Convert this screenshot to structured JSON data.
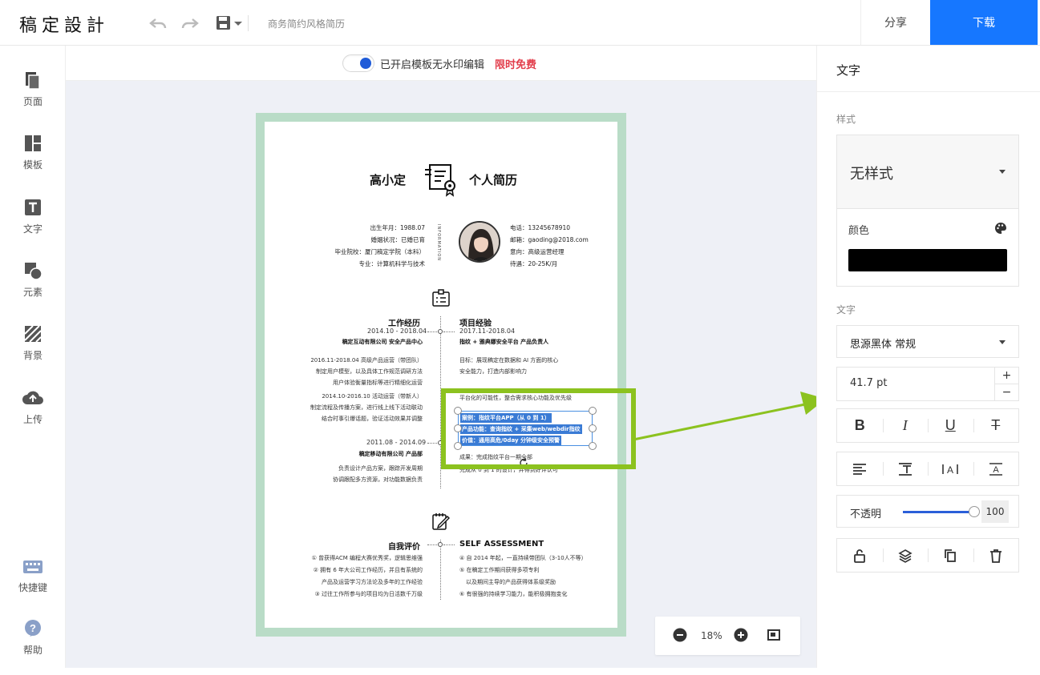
{
  "app": {
    "logo": "稿定設計",
    "doc_title": "商务简约风格简历"
  },
  "topbar": {
    "share": "分享",
    "download": "下载"
  },
  "sidebar": {
    "items": [
      {
        "label": "页面",
        "icon": "pages-icon"
      },
      {
        "label": "模板",
        "icon": "template-icon"
      },
      {
        "label": "文字",
        "icon": "text-icon"
      },
      {
        "label": "元素",
        "icon": "elements-icon"
      },
      {
        "label": "背景",
        "icon": "background-icon"
      },
      {
        "label": "上传",
        "icon": "upload-icon"
      }
    ],
    "bottom": [
      {
        "label": "快捷键",
        "icon": "keyboard-icon"
      },
      {
        "label": "帮助",
        "icon": "help-icon"
      }
    ]
  },
  "watermark": {
    "text": "已开启模板无水印编辑",
    "free": "限时免费",
    "enabled": true
  },
  "resume": {
    "name": "高小定",
    "title": "个人简历",
    "info_vertical": "INFORMATION",
    "left_info": [
      "出生年月：1988.07",
      "婚姻状况：已婚已育",
      "毕业院校：厦门稿定学院（本科）",
      "专业：计算机科学与技术"
    ],
    "right_info": [
      "电话：13245678910",
      "邮箱：gaoding@2018.com",
      "意向：高级运营经理",
      "待遇：20-25K/月"
    ],
    "work": {
      "title": "工作经历",
      "date1": "2014.10 - 2018.04",
      "company1": "稿定互动有限公司 安全产品中心",
      "lines1": [
        "2016.11-2018.04 高级产品运营（带团队）",
        "制定用户模型，以及具体工作规范调研方法",
        "用户体验衡量指标等进行精细化运营"
      ],
      "lines2": [
        "2014.10-2016.10 活动运营（带新人）",
        "制定流程及传播方案，进行线上线下活动联动",
        "结合时事引爆话题，验证活动效果并调整"
      ],
      "date2": "2011.08 - 2014.09",
      "company2": "稿定移动有限公司 产品部",
      "lines3": [
        "负责设计产品方案，跟踪开发周期",
        "协调跟配多方资源，对功能数据负责"
      ]
    },
    "project": {
      "title": "项目经验",
      "date1": "2017.11-2018.04",
      "sub1": "指纹 + 雅典娜安全平台 产品负责人",
      "lines1": [
        "目标：展现稿定在数据和 AI 方面的核心",
        "安全能力，打造内部影响力"
      ],
      "line_mid": "平台化的可能性，整合需求核心功能及优先级",
      "selected": [
        "案例：指纹平台APP（从 0 到 1）",
        "产品功能：查询指纹 + 采集web/webdir指纹",
        "价值：通用高危/0day 分钟级安全预警"
      ],
      "lines2": [
        "成果：完成指纹平台一期全部",
        "完成从 0 到 1 的设计，并得到好评认可"
      ]
    },
    "self": {
      "title": "自我评价",
      "title_en": "SELF ASSESSMENT",
      "left": [
        "① 曾获得ACM 编程大赛优秀奖，逻辑思维强",
        "② 拥有 6 年大公司工作经历，并且有系统的",
        "产品及运营学习方法论及多年的工作经验",
        "③ 过往工作所参与的项目均为日活数千万级"
      ],
      "right": [
        "④ 自 2014 年起，一直持续带团队（3-10人不等）",
        "⑤ 在稿定工作期间获得多项专利",
        "以及期间主导的产品获得体系级奖励",
        "⑥ 有很强的持续学习能力，能积极拥抱变化"
      ]
    }
  },
  "zoom": {
    "value": "18%"
  },
  "panel": {
    "title": "文字",
    "style_label": "样式",
    "style_value": "无样式",
    "color_label": "颜色",
    "color_value": "#000000",
    "text_label": "文字",
    "font": "思源黑体 常规",
    "size": "41.7 pt",
    "plus": "+",
    "minus": "−",
    "opacity_label": "不透明",
    "opacity_value": "100",
    "opacity_fraction": 1.0
  },
  "colors": {
    "accent": "#1677ff",
    "frame": "#b9dcc7",
    "highlight": "#8cc21f",
    "watermark_free": "#e23d4b"
  }
}
